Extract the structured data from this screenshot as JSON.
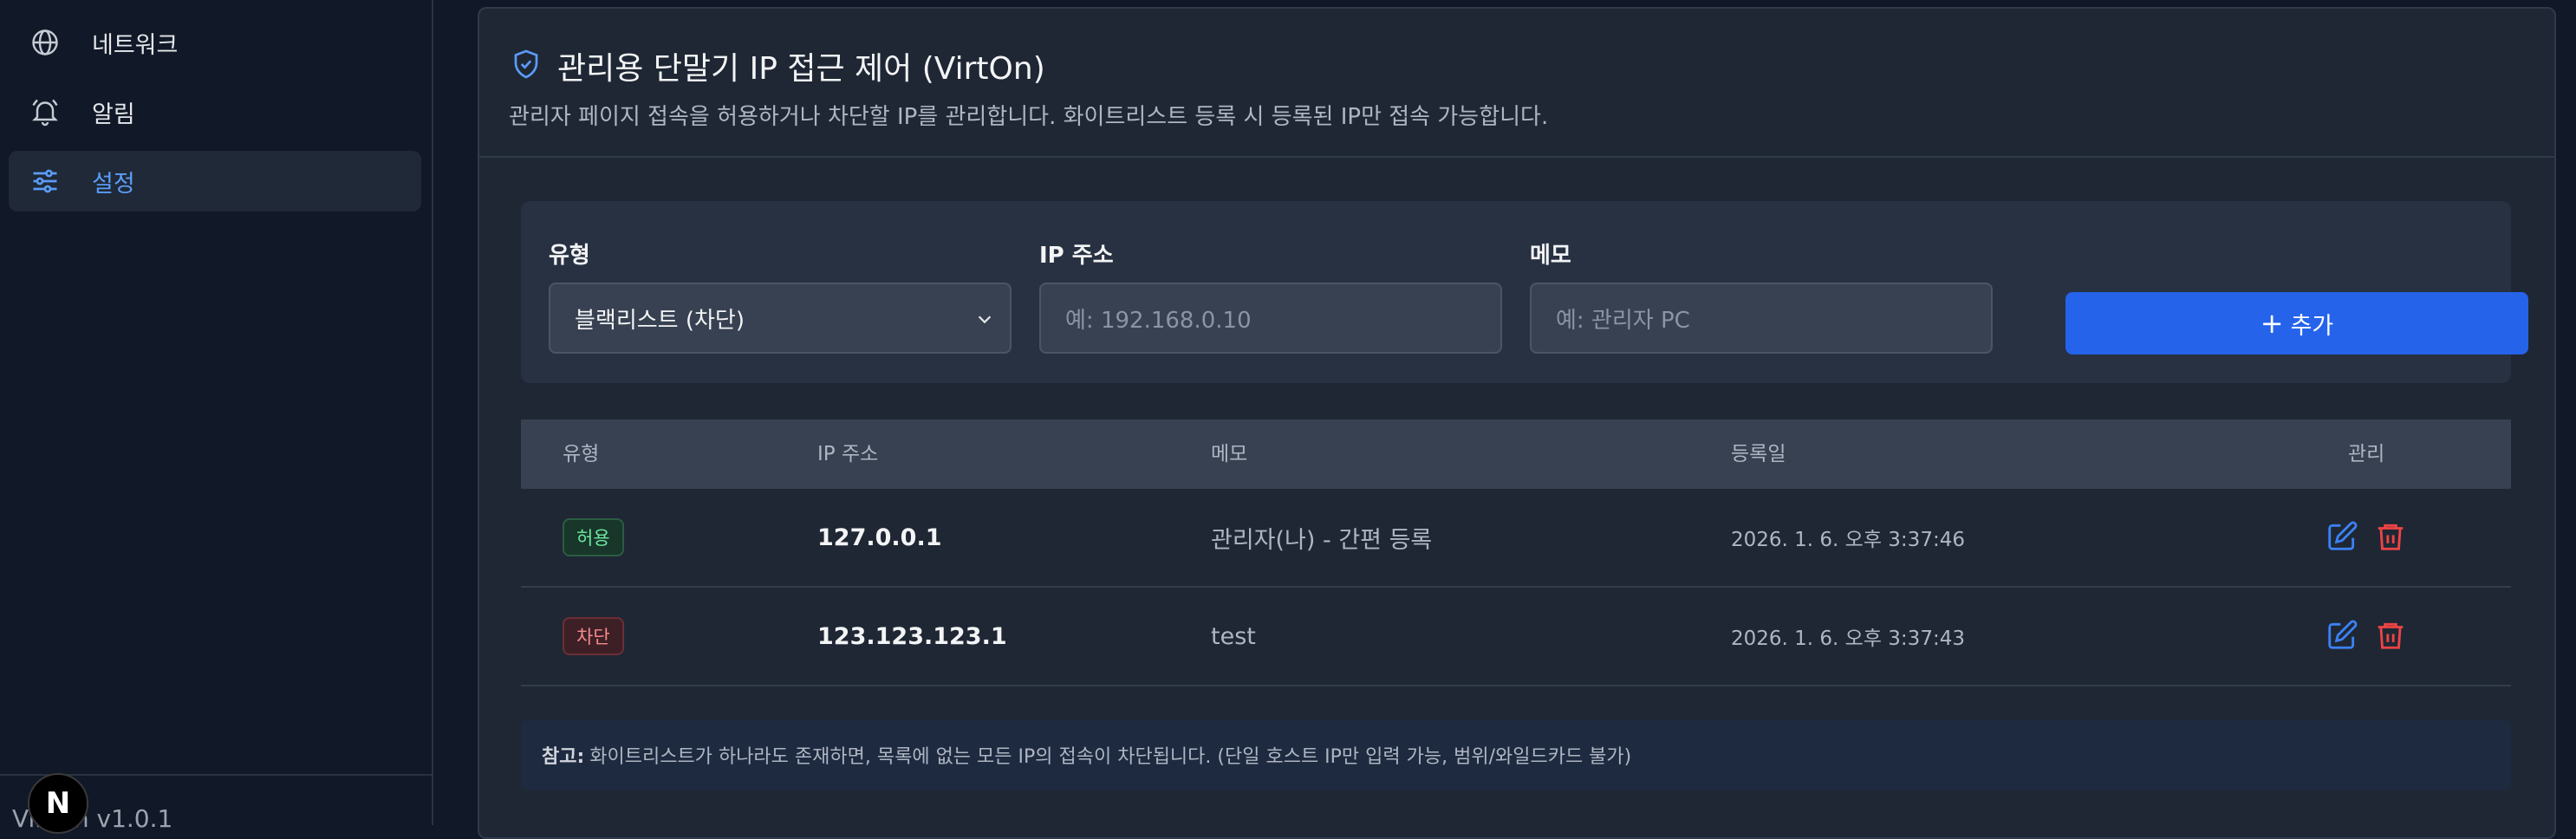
{
  "sidebar": {
    "items": [
      {
        "label": "네트워크",
        "icon": "globe-icon"
      },
      {
        "label": "알림",
        "icon": "bell-icon"
      },
      {
        "label": "설정",
        "icon": "sliders-icon"
      }
    ],
    "version": "VirtOn v1.0.1",
    "badge": "N"
  },
  "card": {
    "title": "관리용 단말기 IP 접근 제어 (VirtOn)",
    "description": "관리자 페이지 접속을 허용하거나 차단할 IP를 관리합니다. 화이트리스트 등록 시 등록된 IP만 접속 가능합니다."
  },
  "form": {
    "type_label": "유형",
    "type_value": "블랙리스트 (차단)",
    "ip_label": "IP 주소",
    "ip_placeholder": "예: 192.168.0.10",
    "memo_label": "메모",
    "memo_placeholder": "예: 관리자 PC",
    "add_label": "추가"
  },
  "table": {
    "headers": [
      "유형",
      "IP 주소",
      "메모",
      "등록일",
      "관리"
    ],
    "rows": [
      {
        "type": "허용",
        "ip": "127.0.0.1",
        "memo": "관리자(나) - 간편 등록",
        "date": "2026. 1. 6. 오후 3:37:46"
      },
      {
        "type": "차단",
        "ip": "123.123.123.1",
        "memo": "test",
        "date": "2026. 1. 6. 오후 3:37:43"
      }
    ]
  },
  "note": {
    "prefix": "참고:",
    "text": "화이트리스트가 하나라도 존재하면, 목록에 없는 모든 IP의 접속이 차단됩니다. (단일 호스트 IP만 입력 가능, 범위/와일드카드 불가)"
  },
  "colors": {
    "accent": "#2563eb",
    "active_nav": "#5b9cf7",
    "allow": "#6ee7a0",
    "block": "#f58b8b",
    "edit_icon": "#3b82f6",
    "delete_icon": "#ef4444"
  }
}
